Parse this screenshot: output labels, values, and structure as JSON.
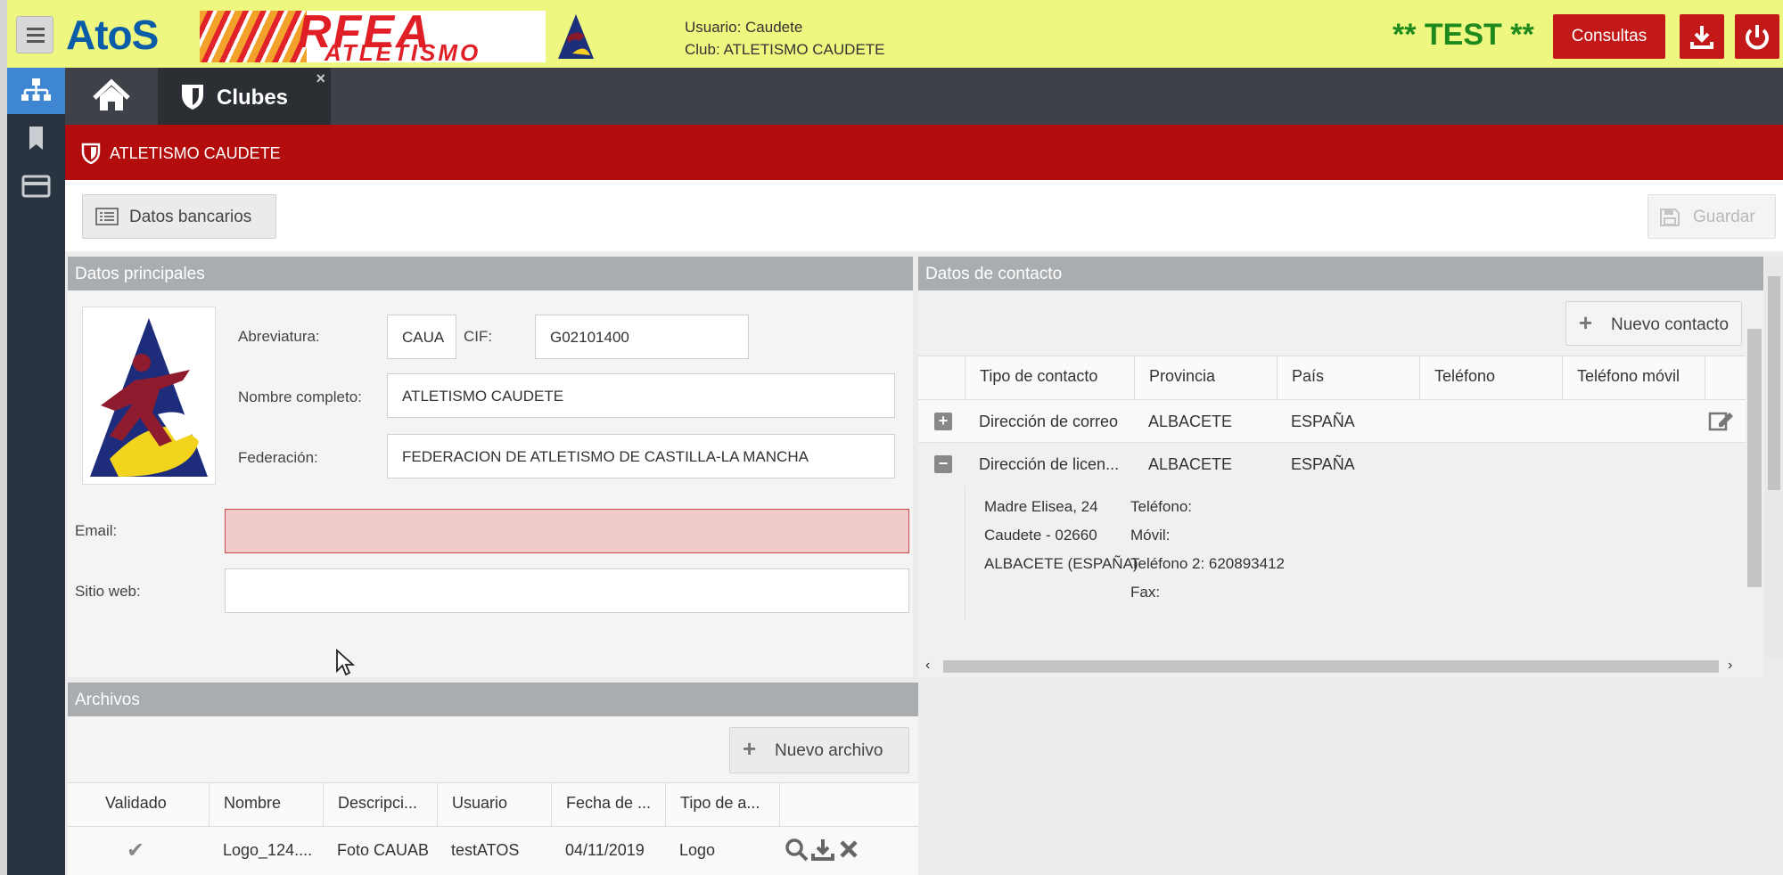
{
  "header": {
    "brand": "AtoS",
    "rfea_title": "RFEA",
    "rfea_subtitle": "ATLETISMO",
    "user_line": "Usuario: Caudete",
    "club_line": "Club: ATLETISMO CAUDETE",
    "test_label": "** TEST **",
    "consultas_label": "Consultas"
  },
  "tabs": [
    {
      "label": "Clubes",
      "close": "×"
    }
  ],
  "page": {
    "title": "ATLETISMO CAUDETE",
    "datos_bancarios_label": "Datos bancarios",
    "guardar_label": "Guardar"
  },
  "datos_principales": {
    "title": "Datos principales",
    "abreviatura_label": "Abreviatura:",
    "abreviatura_value": "CAUA",
    "cif_label": "CIF:",
    "cif_value": "G02101400",
    "nombre_label": "Nombre completo:",
    "nombre_value": "ATLETISMO CAUDETE",
    "federacion_label": "Federación:",
    "federacion_value": "FEDERACION DE ATLETISMO DE CASTILLA-LA MANCHA",
    "email_label": "Email:",
    "email_value": "",
    "web_label": "Sitio web:",
    "web_value": ""
  },
  "datos_contacto": {
    "title": "Datos de contacto",
    "nuevo_contacto_label": "Nuevo contacto",
    "columns": [
      "Tipo de contacto",
      "Provincia",
      "País",
      "Teléfono",
      "Teléfono móvil"
    ],
    "rows": [
      {
        "expander": "+",
        "tipo": "Dirección de correo",
        "provincia": "ALBACETE",
        "pais": "ESPAÑA",
        "telefono": "",
        "movil": ""
      },
      {
        "expander": "−",
        "tipo": "Dirección de licen...",
        "provincia": "ALBACETE",
        "pais": "ESPAÑA",
        "telefono": "",
        "movil": ""
      }
    ],
    "detail": {
      "address1": "Madre Elisea, 24",
      "address2": "Caudete - 02660",
      "address3": "ALBACETE (ESPAÑA)",
      "telefono": "Teléfono:",
      "movil": "Móvil:",
      "telefono2": "Teléfono 2: 620893412",
      "fax": "Fax:"
    }
  },
  "archivos": {
    "title": "Archivos",
    "nuevo_archivo_label": "Nuevo archivo",
    "columns": [
      "Validado",
      "Nombre",
      "Descripci...",
      "Usuario",
      "Fecha de ...",
      "Tipo de a..."
    ],
    "rows": [
      {
        "validado": "✔",
        "nombre": "Logo_124....",
        "descripcion": "Foto CAUAB",
        "usuario": "testATOS",
        "fecha": "04/11/2019",
        "tipo": "Logo"
      }
    ]
  },
  "colors": {
    "topbar": "#eef77f",
    "accent_red": "#b20c0c",
    "button_red": "#c31818",
    "sidenav": "#2a3340",
    "sidenav_active": "#3f86d2",
    "test_green": "#1e8a1e"
  }
}
